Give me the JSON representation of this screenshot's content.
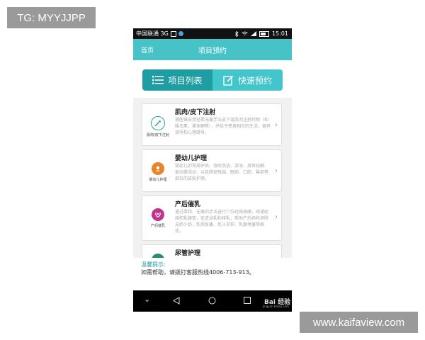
{
  "watermarks": {
    "left": "TG: MYYJJPP",
    "right": "www.kaifaview.com"
  },
  "status_bar": {
    "carrier": "中国联通 3G",
    "time": "15:01"
  },
  "nav": {
    "back": "首页",
    "title": "项目预约"
  },
  "segmented": {
    "tab_list": "项目列表",
    "tab_quick": "快速预约"
  },
  "services": [
    {
      "title": "肌肉/皮下注射",
      "logo_caption": "肌肉/皮下注射",
      "desc": "遵医嘱采用轻柔无痛手法皮下或肌肉注射药物（如胰岛素、黄体酮等），并给予患者相应的生活、营养指导和心理疏导。",
      "accent": "#2aa39a"
    },
    {
      "title": "婴幼儿护理",
      "logo_caption": "婴幼儿护理",
      "desc": "婴幼儿的常规评估、协助洗浴、游泳、身体抚触、被动操活动，以及脐部残端、眼部、口腔、臀部等部位的皮肤护理。",
      "accent": "#e8842a"
    },
    {
      "title": "产后催乳",
      "logo_caption": "产后催乳",
      "desc": "通过柔和、无痛的手法进行穴位经络按摩，疏通经络和乳腺管，促进泌乳和排乳，帮助产后妈妈消除无奶少奶、乳房胀痛、乳汁淤积、乳腺堵塞等困扰。",
      "accent": "#c2338d"
    },
    {
      "title": "尿管护理",
      "logo_caption": "",
      "desc": "",
      "accent": "#2a8a7a"
    }
  ],
  "tips": {
    "label": "温馨提示:",
    "text": "如需帮助，请拨打客服热线4006-713-913。"
  },
  "system_nav": {
    "baidu": "Bai 经验",
    "jingyan": "jingyan.baidu.com"
  },
  "colors": {
    "teal": "#47c3c8",
    "teal_dark": "#1e9ea2"
  }
}
